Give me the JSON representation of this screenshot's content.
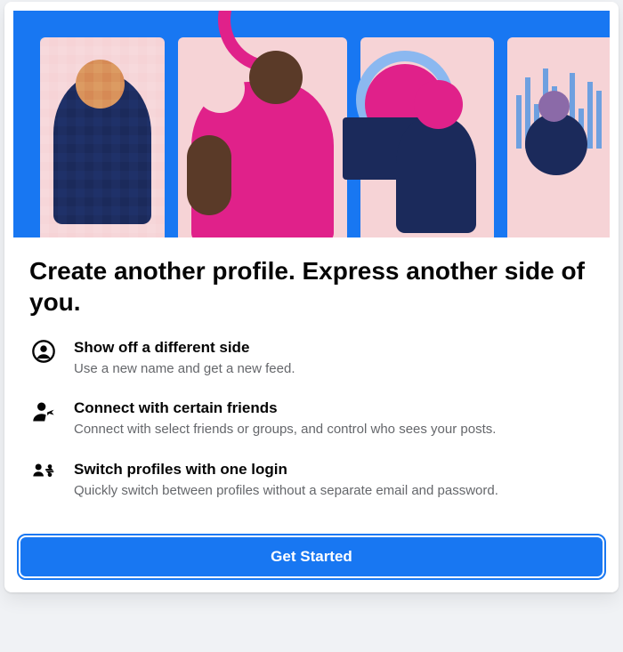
{
  "title": "Create another profile. Express another side of you.",
  "features": [
    {
      "icon": "profile-circle-icon",
      "title": "Show off a different side",
      "desc": "Use a new name and get a new feed."
    },
    {
      "icon": "person-share-icon",
      "title": "Connect with certain friends",
      "desc": "Connect with select friends or groups, and control who sees your posts."
    },
    {
      "icon": "switch-people-icon",
      "title": "Switch profiles with one login",
      "desc": "Quickly switch between profiles without a separate email and password."
    }
  ],
  "cta_label": "Get Started"
}
